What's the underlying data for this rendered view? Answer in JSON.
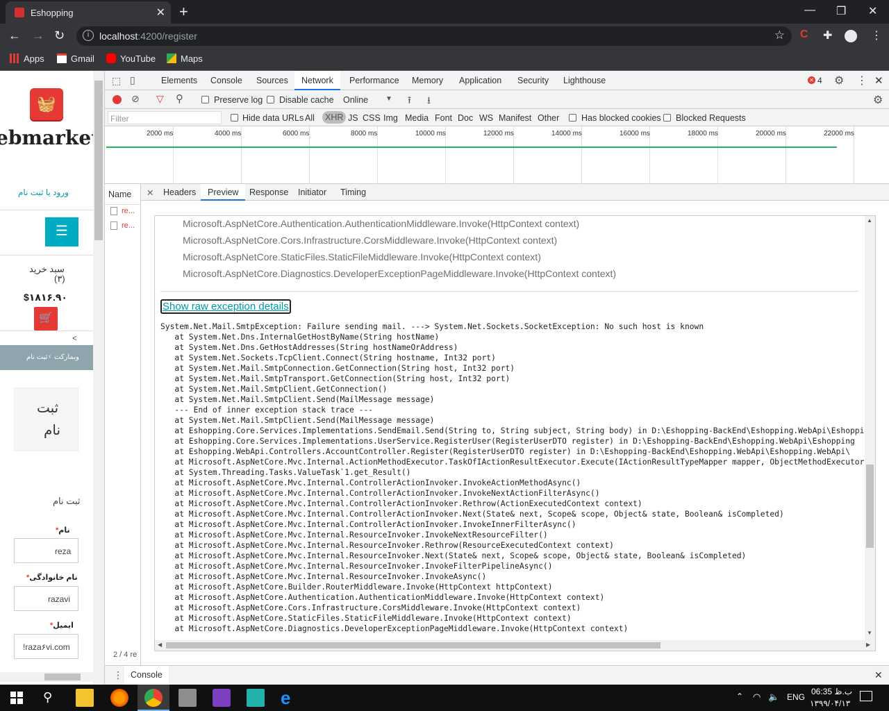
{
  "browser": {
    "tab_title": "Eshopping",
    "url_host": "localhost",
    "url_rest": ":4200/register",
    "bookmarks": [
      "Apps",
      "Gmail",
      "YouTube",
      "Maps"
    ]
  },
  "page": {
    "logo_text": "ebmarket",
    "login_link": "ورود یا ثبت نام",
    "cart_label": "سبد خرید",
    "cart_count": "(۳)",
    "cart_total": "$۱۸۱۶.۹۰",
    "breadcrumb_home": "وبمارکت",
    "breadcrumb_sep": "‹",
    "breadcrumb_current": "ثبت نام",
    "register_title_1": "ثبت",
    "register_title_2": "نام",
    "form_heading": "ثبت نام",
    "fields": [
      {
        "label": "نام",
        "value": "reza"
      },
      {
        "label": "نام خانوادگی",
        "value": "razavi"
      },
      {
        "label": "ایمیل",
        "value": "!raza۶vi.com"
      }
    ],
    "required_mark": "*",
    "collapse_arrow": "<"
  },
  "devtools": {
    "tabs": [
      "Elements",
      "Console",
      "Sources",
      "Network",
      "Performance",
      "Memory",
      "Application",
      "Security",
      "Lighthouse"
    ],
    "active_tab": "Network",
    "error_count": "4",
    "toolbar": {
      "preserve_log": "Preserve log",
      "disable_cache": "Disable cache",
      "throttle": "Online"
    },
    "filter": {
      "placeholder": "Filter",
      "hide_data_urls": "Hide data URLs",
      "types": [
        "All",
        "XHR",
        "JS",
        "CSS",
        "Img",
        "Media",
        "Font",
        "Doc",
        "WS",
        "Manifest",
        "Other"
      ],
      "active_type": "XHR",
      "has_blocked_cookies": "Has blocked cookies",
      "blocked_requests": "Blocked Requests"
    },
    "timeline_ticks": [
      "2000 ms",
      "4000 ms",
      "6000 ms",
      "8000 ms",
      "10000 ms",
      "12000 ms",
      "14000 ms",
      "16000 ms",
      "18000 ms",
      "20000 ms",
      "22000 ms"
    ],
    "name_header": "Name",
    "requests": [
      "re...",
      "re..."
    ],
    "request_count": "2 / 4 re",
    "detail_tabs": [
      "Headers",
      "Preview",
      "Response",
      "Initiator",
      "Timing"
    ],
    "active_detail_tab": "Preview",
    "drawer_tab": "Console",
    "preview": {
      "stack_top": [
        "Microsoft.AspNetCore.Authentication.AuthenticationMiddleware.Invoke(HttpContext context)",
        "Microsoft.AspNetCore.Cors.Infrastructure.CorsMiddleware.Invoke(HttpContext context)",
        "Microsoft.AspNetCore.StaticFiles.StaticFileMiddleware.Invoke(HttpContext context)",
        "Microsoft.AspNetCore.Diagnostics.DeveloperExceptionPageMiddleware.Invoke(HttpContext context)"
      ],
      "raw_link": "Show raw exception details",
      "raw_lines": [
        "System.Net.Mail.SmtpException: Failure sending mail. ---> System.Net.Sockets.SocketException: No such host is known",
        "   at System.Net.Dns.InternalGetHostByName(String hostName)",
        "   at System.Net.Dns.GetHostAddresses(String hostNameOrAddress)",
        "   at System.Net.Sockets.TcpClient.Connect(String hostname, Int32 port)",
        "   at System.Net.Mail.SmtpConnection.GetConnection(String host, Int32 port)",
        "   at System.Net.Mail.SmtpTransport.GetConnection(String host, Int32 port)",
        "   at System.Net.Mail.SmtpClient.GetConnection()",
        "   at System.Net.Mail.SmtpClient.Send(MailMessage message)",
        "   --- End of inner exception stack trace ---",
        "   at System.Net.Mail.SmtpClient.Send(MailMessage message)",
        "   at Eshopping.Core.Services.Implementations.SendEmail.Send(String to, String subject, String body) in D:\\Eshopping-BackEnd\\Eshopping.WebApi\\Eshopping",
        "   at Eshopping.Core.Services.Implementations.UserService.RegisterUser(RegisterUserDTO register) in D:\\Eshopping-BackEnd\\Eshopping.WebApi\\Eshopping",
        "   at Eshopping.WebApi.Controllers.AccountController.Register(RegisterUserDTO register) in D:\\Eshopping-BackEnd\\Eshopping.WebApi\\Eshopping.WebApi\\",
        "   at Microsoft.AspNetCore.Mvc.Internal.ActionMethodExecutor.TaskOfIActionResultExecutor.Execute(IActionResultTypeMapper mapper, ObjectMethodExecutor",
        "   at System.Threading.Tasks.ValueTask`1.get_Result()",
        "   at Microsoft.AspNetCore.Mvc.Internal.ControllerActionInvoker.InvokeActionMethodAsync()",
        "   at Microsoft.AspNetCore.Mvc.Internal.ControllerActionInvoker.InvokeNextActionFilterAsync()",
        "   at Microsoft.AspNetCore.Mvc.Internal.ControllerActionInvoker.Rethrow(ActionExecutedContext context)",
        "   at Microsoft.AspNetCore.Mvc.Internal.ControllerActionInvoker.Next(State& next, Scope& scope, Object& state, Boolean& isCompleted)",
        "   at Microsoft.AspNetCore.Mvc.Internal.ControllerActionInvoker.InvokeInnerFilterAsync()",
        "   at Microsoft.AspNetCore.Mvc.Internal.ResourceInvoker.InvokeNextResourceFilter()",
        "   at Microsoft.AspNetCore.Mvc.Internal.ResourceInvoker.Rethrow(ResourceExecutedContext context)",
        "   at Microsoft.AspNetCore.Mvc.Internal.ResourceInvoker.Next(State& next, Scope& scope, Object& state, Boolean& isCompleted)",
        "   at Microsoft.AspNetCore.Mvc.Internal.ResourceInvoker.InvokeFilterPipelineAsync()",
        "   at Microsoft.AspNetCore.Mvc.Internal.ResourceInvoker.InvokeAsync()",
        "   at Microsoft.AspNetCore.Builder.RouterMiddleware.Invoke(HttpContext httpContext)",
        "   at Microsoft.AspNetCore.Authentication.AuthenticationMiddleware.Invoke(HttpContext context)",
        "   at Microsoft.AspNetCore.Cors.Infrastructure.CorsMiddleware.Invoke(HttpContext context)",
        "   at Microsoft.AspNetCore.StaticFiles.StaticFileMiddleware.Invoke(HttpContext context)",
        "   at Microsoft.AspNetCore.Diagnostics.DeveloperExceptionPageMiddleware.Invoke(HttpContext context)"
      ]
    }
  },
  "taskbar": {
    "language": "ENG",
    "time": "06:35 ب.ظ",
    "date": "۱۳۹۹/۰۴/۱۳"
  },
  "colors": {
    "accent": "#1a73e8",
    "brand_red": "#e53935",
    "teal": "#00acc1",
    "link_teal": "#0097a7"
  }
}
